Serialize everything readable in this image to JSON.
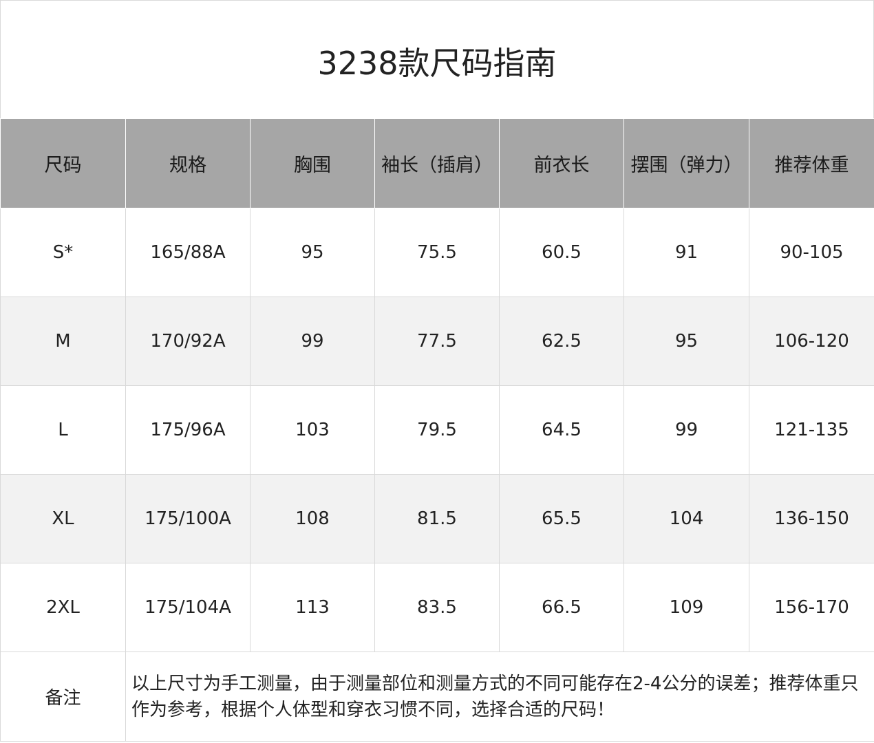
{
  "title": "3238款尺码指南",
  "table": {
    "headers": [
      "尺码",
      "规格",
      "胸围",
      "袖长（插肩）",
      "前衣长",
      "摆围（弹力）",
      "推荐体重"
    ],
    "rows": [
      [
        "S*",
        "165/88A",
        "95",
        "75.5",
        "60.5",
        "91",
        "90-105"
      ],
      [
        "M",
        "170/92A",
        "99",
        "77.5",
        "62.5",
        "95",
        "106-120"
      ],
      [
        "L",
        "175/96A",
        "103",
        "79.5",
        "64.5",
        "99",
        "121-135"
      ],
      [
        "XL",
        "175/100A",
        "108",
        "81.5",
        "65.5",
        "104",
        "136-150"
      ],
      [
        "2XL",
        "175/104A",
        "113",
        "83.5",
        "66.5",
        "109",
        "156-170"
      ]
    ]
  },
  "note": {
    "label": "备注",
    "text": "以上尺寸为手工测量，由于测量部位和测量方式的不同可能存在2-4公分的误差；推荐体重只作为参考，根据个人体型和穿衣习惯不同，选择合适的尺码！"
  },
  "colors": {
    "header_bg": "#a6a6a6",
    "stripe_bg": "#f2f2f2",
    "border": "#d9d9d9"
  }
}
